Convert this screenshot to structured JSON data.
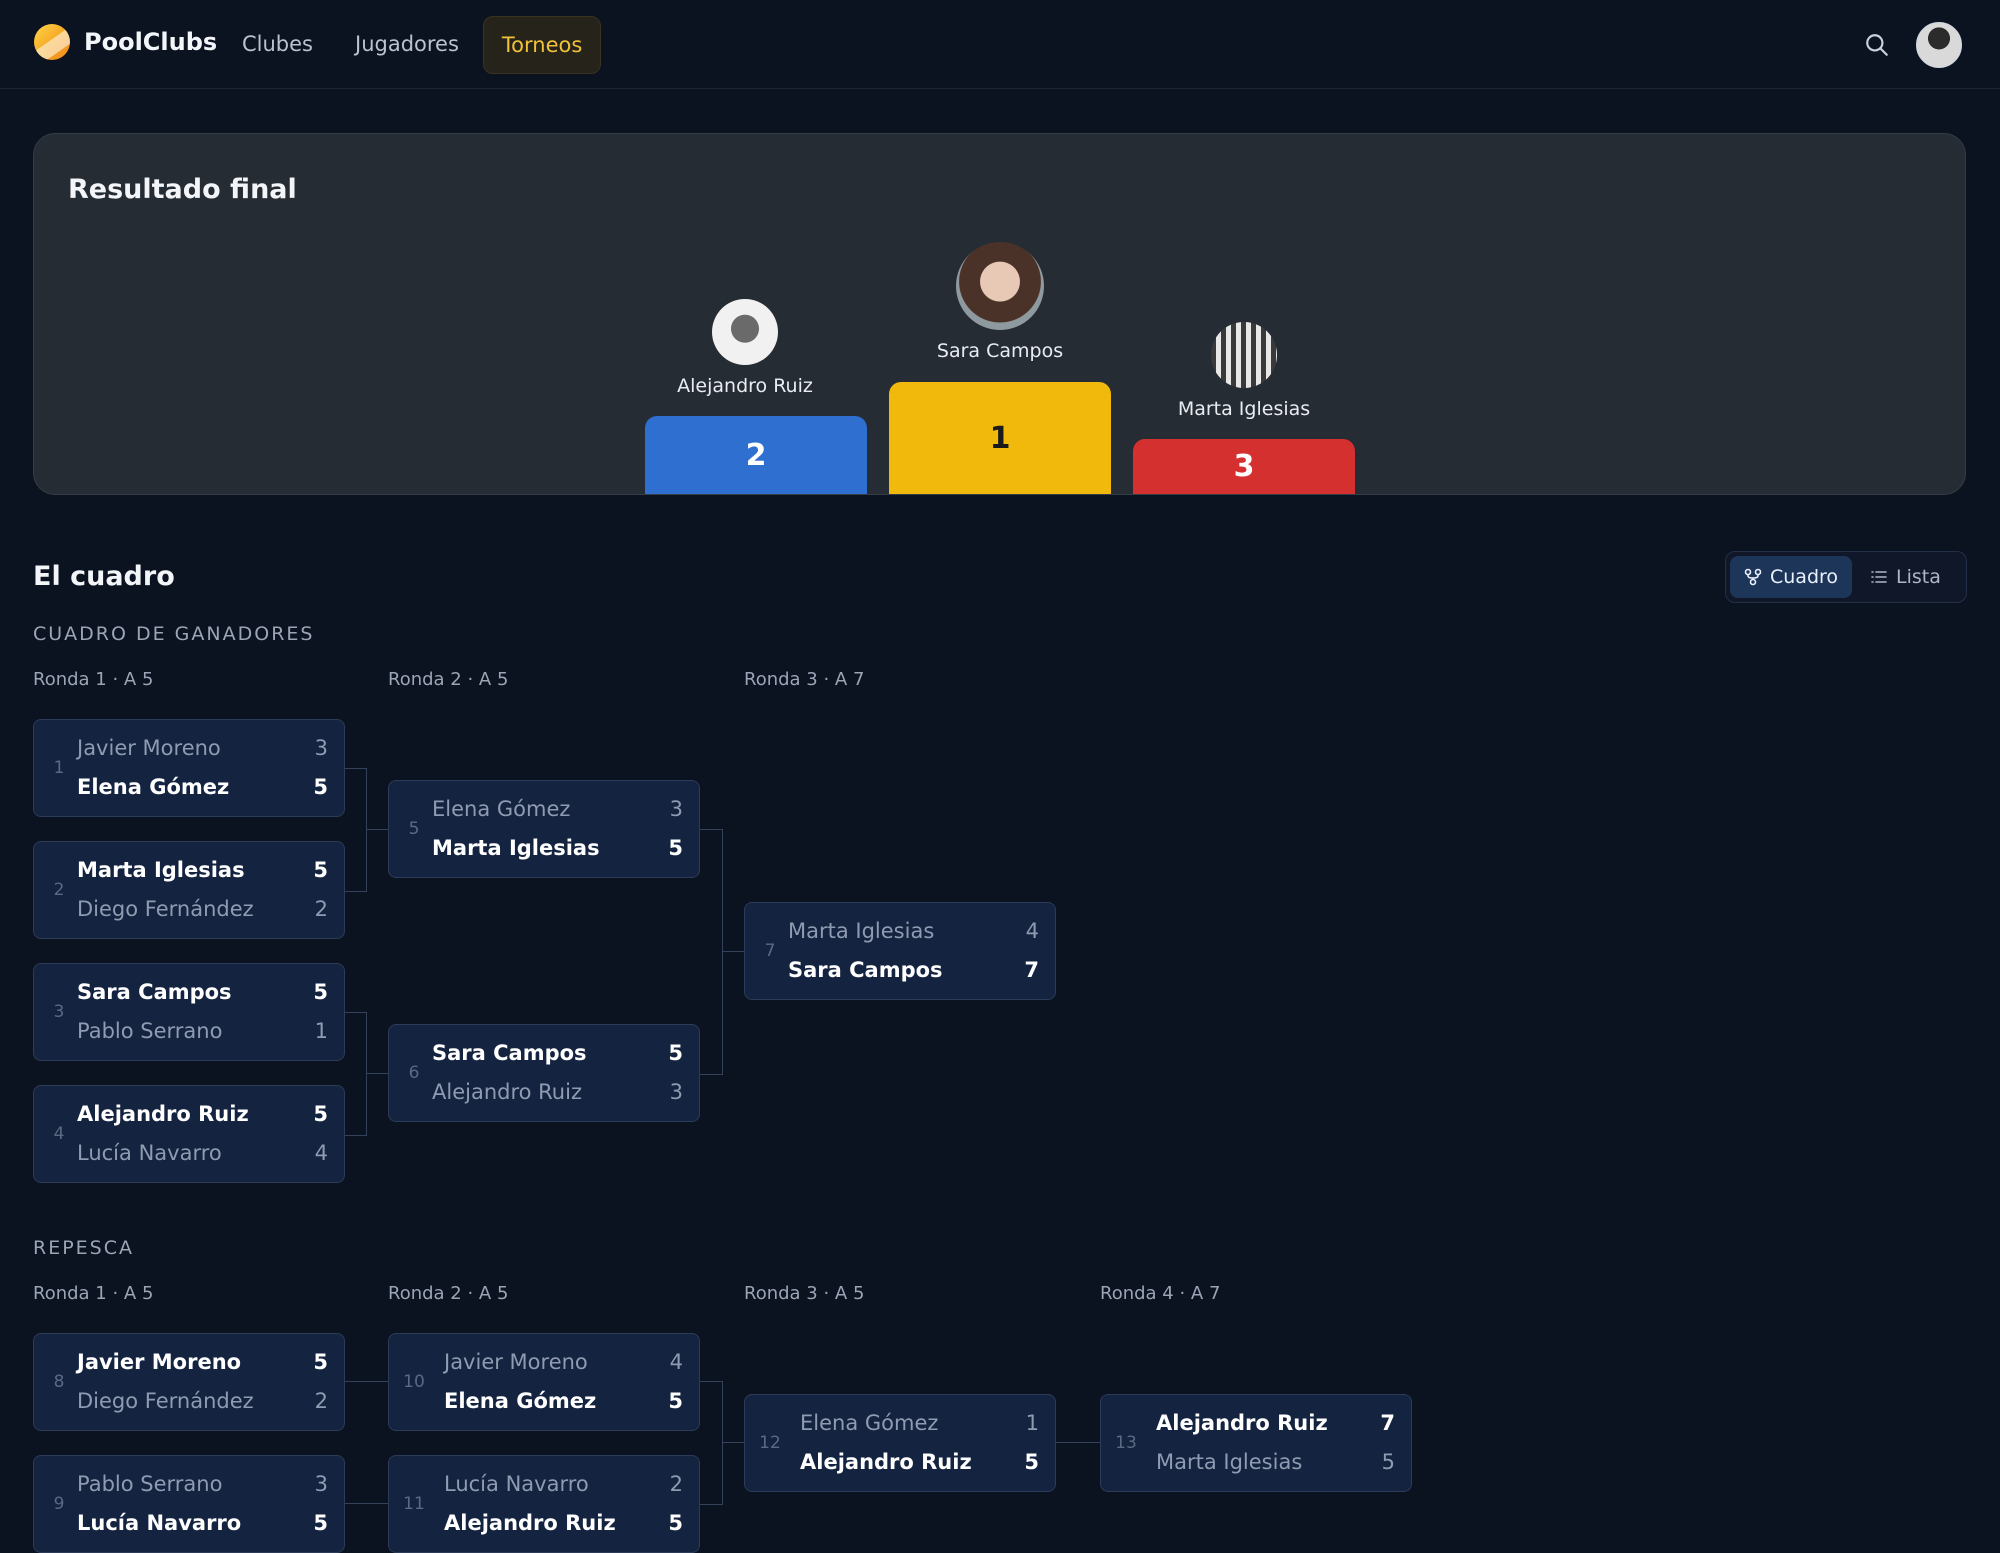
{
  "header": {
    "brand": "PoolClubs",
    "nav": [
      "Clubes",
      "Jugadores",
      "Torneos"
    ],
    "active_nav": "Torneos"
  },
  "result": {
    "title": "Resultado final",
    "podium": [
      {
        "place": "2",
        "name": "Alejandro Ruiz",
        "color": "#2f6fd0"
      },
      {
        "place": "1",
        "name": "Sara Campos",
        "color": "#f0b90b"
      },
      {
        "place": "3",
        "name": "Marta Iglesias",
        "color": "#d53030"
      }
    ]
  },
  "bracket": {
    "title": "El cuadro",
    "view_toggle": {
      "cuadro": "Cuadro",
      "lista": "Lista",
      "active": "Cuadro"
    },
    "winners": {
      "label": "CUADRO DE GANADORES",
      "rounds": [
        "Ronda 1 · A 5",
        "Ronda 2 · A 5",
        "Ronda 3 · A 7"
      ],
      "matches": [
        {
          "num": "1",
          "p1": "Javier Moreno",
          "s1": "3",
          "p2": "Elena Gómez",
          "s2": "5"
        },
        {
          "num": "2",
          "p1": "Marta Iglesias",
          "s1": "5",
          "p2": "Diego Fernández",
          "s2": "2"
        },
        {
          "num": "3",
          "p1": "Sara Campos",
          "s1": "5",
          "p2": "Pablo Serrano",
          "s2": "1"
        },
        {
          "num": "4",
          "p1": "Alejandro Ruiz",
          "s1": "5",
          "p2": "Lucía Navarro",
          "s2": "4"
        },
        {
          "num": "5",
          "p1": "Elena Gómez",
          "s1": "3",
          "p2": "Marta Iglesias",
          "s2": "5"
        },
        {
          "num": "6",
          "p1": "Sara Campos",
          "s1": "5",
          "p2": "Alejandro Ruiz",
          "s2": "3"
        },
        {
          "num": "7",
          "p1": "Marta Iglesias",
          "s1": "4",
          "p2": "Sara Campos",
          "s2": "7"
        }
      ]
    },
    "losers": {
      "label": "REPESCA",
      "rounds": [
        "Ronda 1 · A 5",
        "Ronda 2 · A 5",
        "Ronda 3 · A 5",
        "Ronda 4 · A 7"
      ],
      "matches": [
        {
          "num": "8",
          "p1": "Javier Moreno",
          "s1": "5",
          "p2": "Diego Fernández",
          "s2": "2"
        },
        {
          "num": "9",
          "p1": "Pablo Serrano",
          "s1": "3",
          "p2": "Lucía Navarro",
          "s2": "5"
        },
        {
          "num": "10",
          "p1": "Javier Moreno",
          "s1": "4",
          "p2": "Elena Gómez",
          "s2": "5"
        },
        {
          "num": "11",
          "p1": "Lucía Navarro",
          "s1": "2",
          "p2": "Alejandro Ruiz",
          "s2": "5"
        },
        {
          "num": "12",
          "p1": "Elena Gómez",
          "s1": "1",
          "p2": "Alejandro Ruiz",
          "s2": "5"
        },
        {
          "num": "13",
          "p1": "Alejandro Ruiz",
          "s1": "7",
          "p2": "Marta Iglesias",
          "s2": "5"
        }
      ]
    }
  }
}
